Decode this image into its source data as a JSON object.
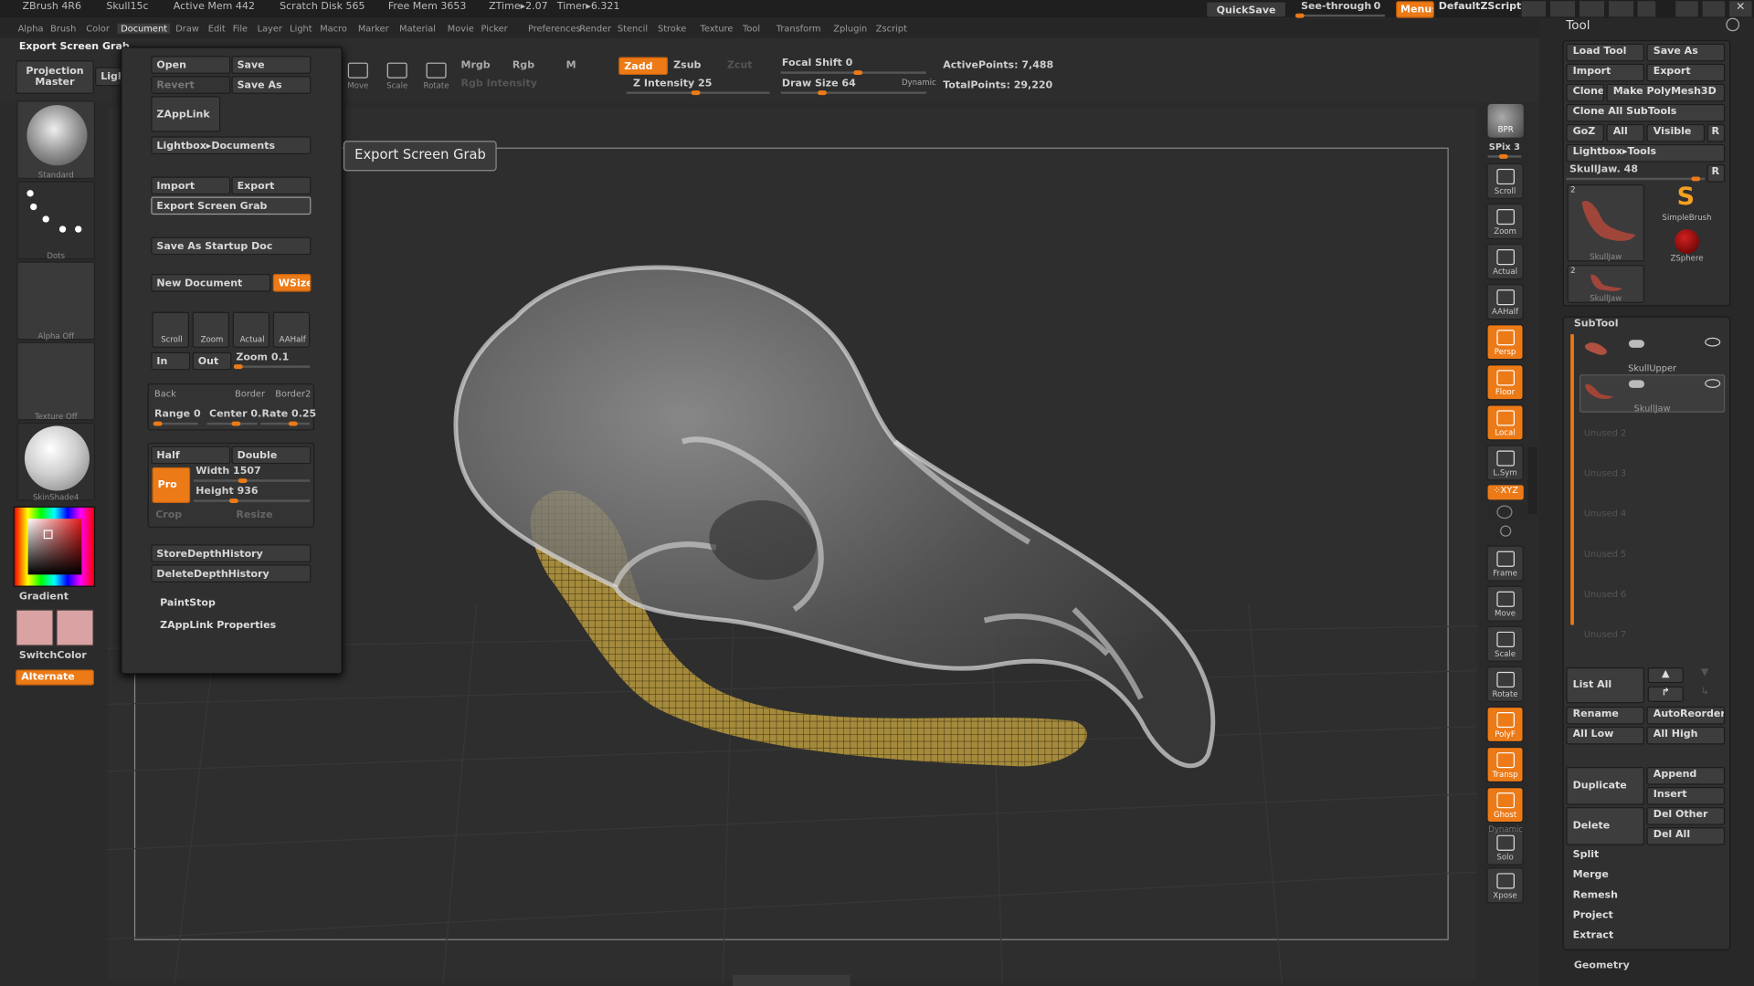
{
  "titlebar": {
    "app": "ZBrush 4R6",
    "file": "Skull15c",
    "active_mem": "Active Mem 442",
    "scratch_disk": "Scratch Disk 565",
    "free_mem": "Free Mem 3653",
    "ztime": "ZTime▸2.07",
    "timer": "Timer▸6.321",
    "quicksave": "QuickSave",
    "seethrough": "See-through",
    "seethrough_value": "0",
    "menus": "Menus",
    "script": "DefaultZScript"
  },
  "menubar": [
    "Alpha",
    "Brush",
    "Color",
    "Document",
    "Draw",
    "Edit",
    "File",
    "Layer",
    "Light",
    "Macro",
    "Marker",
    "Material",
    "Movie",
    "Picker",
    "Preferences",
    "Render",
    "Stencil",
    "Stroke",
    "Texture",
    "Tool",
    "Transform",
    "Zplugin",
    "Zscript"
  ],
  "active_menu": "Document",
  "topbar": {
    "menu_title": "Export Screen Grab",
    "projection_master": "Projection Master",
    "lightbox": "LightBox",
    "move": "Move",
    "scale": "Scale",
    "rotate": "Rotate",
    "mrgb": "Mrgb",
    "rgb": "Rgb",
    "m": "M",
    "rgb_intensity": "Rgb Intensity",
    "zadd": "Zadd",
    "zsub": "Zsub",
    "zcut": "Zcut",
    "z_intensity": "Z Intensity 25",
    "focal_shift": "Focal Shift 0",
    "draw_size": "Draw Size 64",
    "dynamic": "Dynamic",
    "active_points": "ActivePoints: 7,488",
    "total_points": "TotalPoints: 29,220"
  },
  "left_shelf": {
    "standard": "Standard",
    "dots": "Dots",
    "alpha_off": "Alpha Off",
    "texture_off": "Texture Off",
    "skinshade": "SkinShade4",
    "gradient": "Gradient",
    "switchcolor": "SwitchColor",
    "alternate": "Alternate"
  },
  "doc_menu": {
    "open": "Open",
    "save": "Save",
    "revert": "Revert",
    "save_as": "Save As",
    "zapplink": "ZAppLink",
    "lightbox_documents": "Lightbox▸Documents",
    "import": "Import",
    "export": "Export",
    "export_screen_grab": "Export Screen Grab",
    "save_startup": "Save As Startup Doc",
    "new_document": "New Document",
    "wsize": "WSize",
    "scroll": "Scroll",
    "zoom": "Zoom",
    "actual": "Actual",
    "aahalf": "AAHalf",
    "in": "In",
    "out": "Out",
    "zoom_value": "Zoom 0.1",
    "back": "Back",
    "border": "Border",
    "border2": "Border2",
    "range": "Range 0",
    "center": "Center 0.",
    "rate": "Rate 0.25",
    "half": "Half",
    "double": "Double",
    "pro": "Pro",
    "width": "Width 1507",
    "height": "Height 936",
    "crop": "Crop",
    "resize": "Resize",
    "store_depth": "StoreDepthHistory",
    "delete_depth": "DeleteDepthHistory",
    "paintstop": "PaintStop",
    "zapplink_properties": "ZAppLink Properties"
  },
  "tooltip": "Export Screen Grab",
  "right_shelf": {
    "bpr": "BPR",
    "spix": "SPix 3",
    "scroll": "Scroll",
    "zoom": "Zoom",
    "actual": "Actual",
    "aahalf": "AAHalf",
    "persp": "Persp",
    "floor": "Floor",
    "local": "Local",
    "lsym": "L.Sym",
    "xyz": "⁘XYZ",
    "frame": "Frame",
    "move": "Move",
    "scale": "Scale",
    "rotate": "Rotate",
    "polyf": "PolyF",
    "transp": "Transp",
    "ghost": "Ghost",
    "dynamic": "Dynamic",
    "solo": "Solo",
    "xpose": "Xpose"
  },
  "tool_panel": {
    "title": "Tool",
    "load_tool": "Load Tool",
    "save_as": "Save As",
    "import": "Import",
    "export": "Export",
    "clone": "Clone",
    "make_polymesh": "Make PolyMesh3D",
    "clone_all": "Clone All SubTools",
    "goz": "GoZ",
    "all": "All",
    "visible": "Visible",
    "r": "R",
    "lightbox_tools": "Lightbox▸Tools",
    "current_tool": "SkullJaw. 48",
    "thumb1": "SkullJaw",
    "thumb1_count": "2",
    "simplebrush": "SimpleBrush",
    "zsphere": "ZSphere",
    "thumb2": "SkullJaw",
    "thumb2_count": "2"
  },
  "subtool": {
    "title": "SubTool",
    "items": [
      "SkullUpper",
      "SkullJaw"
    ],
    "unused": [
      "Unused 2",
      "Unused 3",
      "Unused 4",
      "Unused 5",
      "Unused 6",
      "Unused 7"
    ],
    "list_all": "List All",
    "rename": "Rename",
    "autoreorder": "AutoReorder",
    "all_low": "All Low",
    "all_high": "All High",
    "duplicate": "Duplicate",
    "append": "Append",
    "insert": "Insert",
    "delete": "Delete",
    "del_other": "Del Other",
    "del_all": "Del All",
    "split": "Split",
    "merge": "Merge",
    "remesh": "Remesh",
    "project": "Project",
    "extract": "Extract",
    "geometry": "Geometry"
  },
  "colors": {
    "accent": "#ec7a16",
    "bg": "#2b2b2b",
    "panel": "#3b3b3b"
  }
}
